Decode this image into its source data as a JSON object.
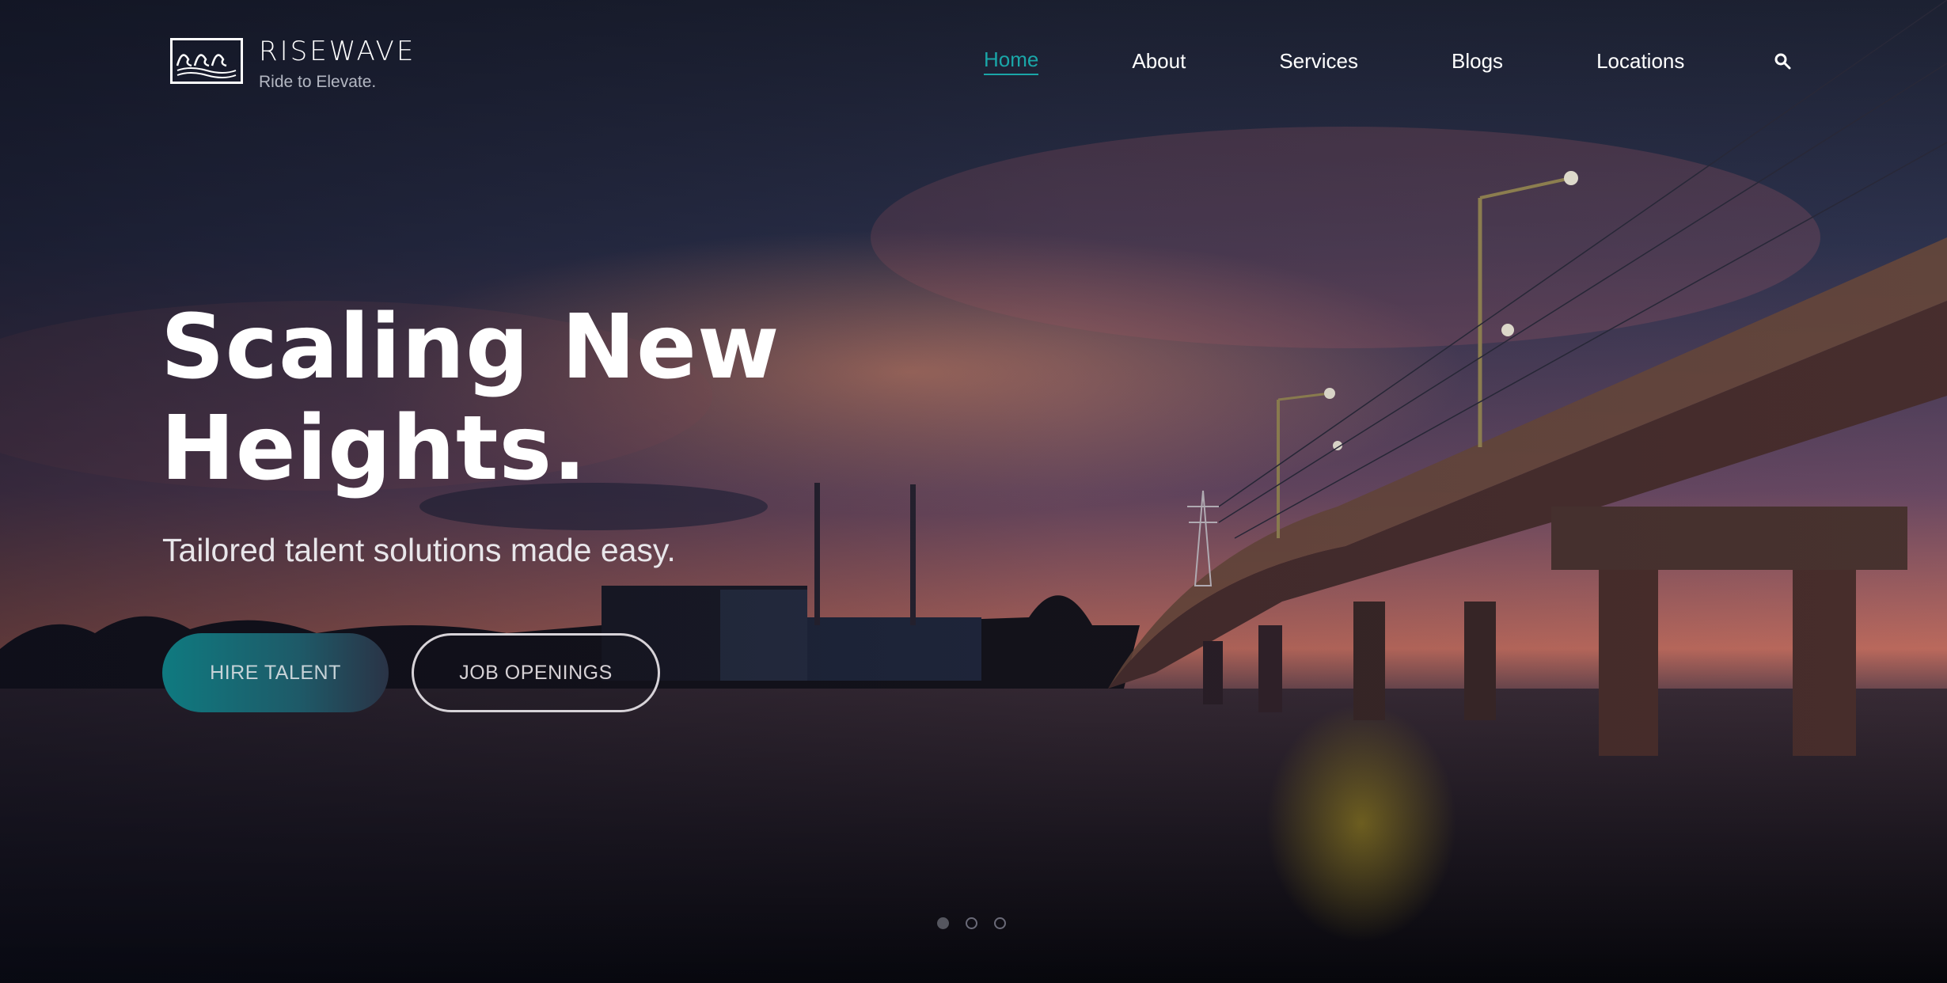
{
  "brand": {
    "name": "RISEWAVE",
    "tagline": "Ride to Elevate.",
    "logo_icon": "wave-logo-icon"
  },
  "nav": {
    "items": [
      {
        "label": "Home",
        "active": true
      },
      {
        "label": "About",
        "active": false
      },
      {
        "label": "Services",
        "active": false
      },
      {
        "label": "Blogs",
        "active": false
      },
      {
        "label": "Locations",
        "active": false
      }
    ],
    "search_icon": "search-icon",
    "active_color": "#1aa6a8"
  },
  "hero": {
    "headline_line1": "Scaling New",
    "headline_line2": "Heights.",
    "subheadline": "Tailored talent solutions made easy.",
    "primary_button": "HIRE TALENT",
    "secondary_button": "JOB OPENINGS",
    "slides": {
      "count": 3,
      "active_index": 0
    }
  },
  "colors": {
    "accent": "#1aa6a8",
    "primary_button_start": "#0f7a80",
    "text": "#ffffff"
  }
}
